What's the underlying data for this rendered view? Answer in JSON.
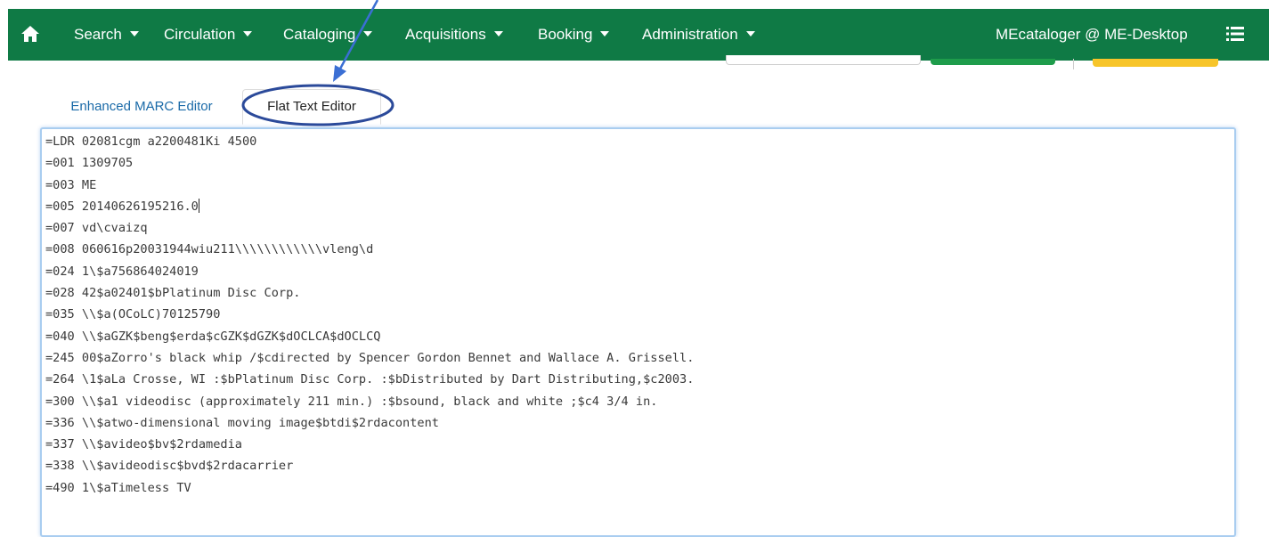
{
  "navbar": {
    "home_icon": "home-icon",
    "menu_icon": "hamburger-icon",
    "items": [
      {
        "label": "Search"
      },
      {
        "label": "Circulation"
      },
      {
        "label": "Cataloging"
      },
      {
        "label": "Acquisitions"
      },
      {
        "label": "Booking"
      },
      {
        "label": "Administration"
      }
    ],
    "user": "MEcataloger @ ME-Desktop",
    "color": "#0f7a45"
  },
  "tabs": [
    {
      "label": "Enhanced MARC Editor",
      "active": false
    },
    {
      "label": "Flat Text Editor",
      "active": true
    }
  ],
  "editor": {
    "lines": [
      "=LDR 02081cgm a2200481Ki 4500",
      "=001 1309705",
      "=003 ME",
      "=005 20140626195216.0",
      "=007 vd\\cvaizq",
      "=008 060616p20031944wiu211\\\\\\\\\\\\\\\\\\\\\\\\vleng\\d",
      "=024 1\\$a756864024019",
      "=028 42$a02401$bPlatinum Disc Corp.",
      "=035 \\\\$a(OCoLC)70125790",
      "=040 \\\\$aGZK$beng$erda$cGZK$dGZK$dOCLCA$dOCLCQ",
      "=245 00$aZorro's black whip /$cdirected by Spencer Gordon Bennet and Wallace A. Grissell.",
      "=264 \\1$aLa Crosse, WI :$bPlatinum Disc Corp. :$bDistributed by Dart Distributing,$c2003.",
      "=300 \\\\$a1 videodisc (approximately 211 min.) :$bsound, black and white ;$c4 3/4 in.",
      "=336 \\\\$atwo-dimensional moving image$btdi$2rdacontent",
      "=337 \\\\$avideo$bv$2rdamedia",
      "=338 \\\\$avideodisc$bvd$2rdacarrier",
      "=490 1\\$aTimeless TV"
    ]
  },
  "annotation": {
    "color": "#2b4a9a",
    "shapes": [
      "arrow",
      "ellipse"
    ]
  }
}
